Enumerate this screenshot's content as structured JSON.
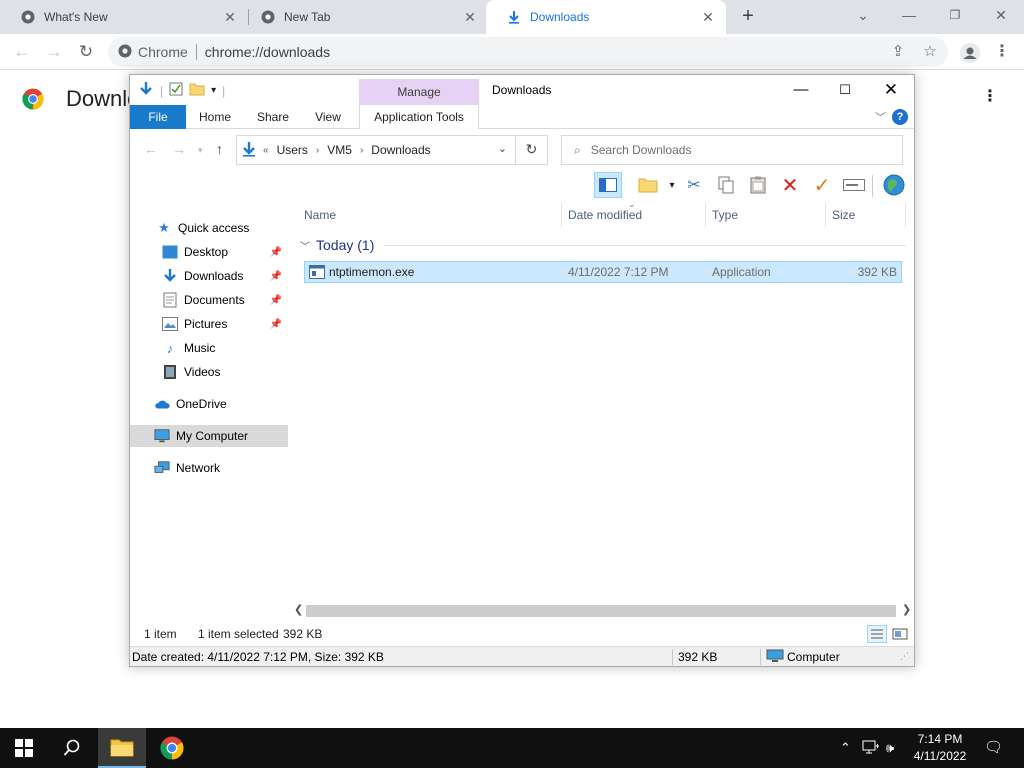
{
  "browser": {
    "tabs": [
      {
        "title": "What's New",
        "active": false
      },
      {
        "title": "New Tab",
        "active": false
      },
      {
        "title": "Downloads",
        "active": true
      }
    ],
    "omnibox": {
      "site_label": "Chrome",
      "url": "chrome://downloads"
    },
    "page_title": "Downloads"
  },
  "explorer": {
    "window_title": "Downloads",
    "context_tab": "Manage",
    "ribbon_tabs": [
      "File",
      "Home",
      "Share",
      "View",
      "Application Tools"
    ],
    "address": {
      "overflow": "«",
      "crumbs": [
        "Users",
        "VM5",
        "Downloads"
      ]
    },
    "search_placeholder": "Search Downloads",
    "sidebar": [
      {
        "label": "Quick access",
        "icon": "star-icon",
        "pinned": false
      },
      {
        "label": "Desktop",
        "icon": "desktop-icon",
        "pinned": true
      },
      {
        "label": "Downloads",
        "icon": "downloads-icon",
        "pinned": true
      },
      {
        "label": "Documents",
        "icon": "documents-icon",
        "pinned": true
      },
      {
        "label": "Pictures",
        "icon": "pictures-icon",
        "pinned": true
      },
      {
        "label": "Music",
        "icon": "music-icon",
        "pinned": false
      },
      {
        "label": "Videos",
        "icon": "videos-icon",
        "pinned": false
      },
      {
        "label": "OneDrive",
        "icon": "cloud-icon",
        "pinned": false
      },
      {
        "label": "My Computer",
        "icon": "computer-icon",
        "pinned": false,
        "selected": true
      },
      {
        "label": "Network",
        "icon": "network-icon",
        "pinned": false
      }
    ],
    "columns": [
      "Name",
      "Date modified",
      "Type",
      "Size"
    ],
    "group": {
      "label": "Today (1)"
    },
    "files": [
      {
        "name": "ntptimemon.exe",
        "date": "4/11/2022 7:12 PM",
        "type": "Application",
        "size": "392 KB",
        "selected": true
      }
    ],
    "status": {
      "count": "1 item",
      "selected": "1 item selected",
      "selected_size": "392 KB"
    },
    "details_bar": {
      "info": "Date created: 4/11/2022 7:12 PM, Size: 392 KB",
      "size": "392 KB",
      "location": "Computer"
    }
  },
  "taskbar": {
    "time": "7:14 PM",
    "date": "4/11/2022"
  },
  "colors": {
    "chrome_tabstrip": "#dee1e6",
    "file_tab": "#1979ca",
    "manage_tab": "#e6d2f4",
    "selection": "#cce8ff",
    "taskbar": "#101010"
  }
}
